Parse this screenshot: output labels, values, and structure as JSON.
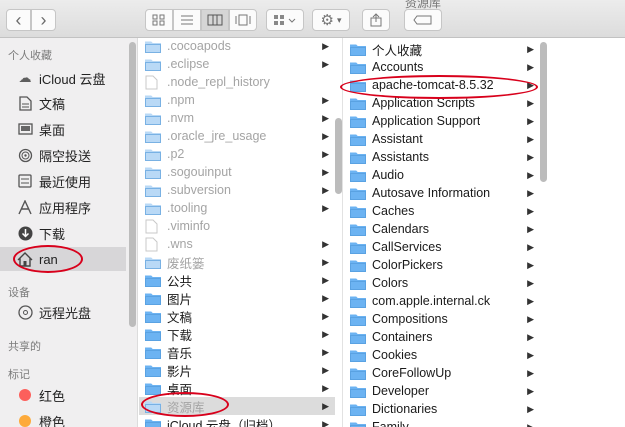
{
  "window": {
    "title": "资源库"
  },
  "toolbar": {
    "back": "‹",
    "forward": "›",
    "view_icons": [
      "icon-view",
      "list-view",
      "column-view",
      "gallery-view"
    ],
    "arrange": "arrange-menu",
    "action": "gear-menu",
    "share": "share",
    "tags": "tags"
  },
  "sidebar": {
    "favorites_header": "个人收藏",
    "favorites": [
      {
        "label": "iCloud 云盘",
        "icon": "cloud-icon"
      },
      {
        "label": "文稿",
        "icon": "document-icon"
      },
      {
        "label": "桌面",
        "icon": "desktop-icon"
      },
      {
        "label": "隔空投送",
        "icon": "airdrop-icon"
      },
      {
        "label": "最近使用",
        "icon": "recents-icon"
      },
      {
        "label": "应用程序",
        "icon": "applications-icon"
      },
      {
        "label": "下载",
        "icon": "downloads-icon"
      },
      {
        "label": "ran",
        "icon": "home-icon",
        "selected": true
      }
    ],
    "devices_header": "设备",
    "devices": [
      {
        "label": "远程光盘",
        "icon": "disc-icon"
      }
    ],
    "shared_header": "共享的",
    "tags_header": "标记",
    "tags": [
      {
        "label": "红色",
        "color": "#fc605c"
      },
      {
        "label": "橙色",
        "color": "#fdaa3b"
      }
    ]
  },
  "column1": {
    "items": [
      {
        "label": ".cocoapods",
        "kind": "folder",
        "dim": true,
        "arrow": true
      },
      {
        "label": ".eclipse",
        "kind": "folder",
        "dim": true,
        "arrow": true
      },
      {
        "label": ".node_repl_history",
        "kind": "file",
        "dim": true,
        "arrow": false
      },
      {
        "label": ".npm",
        "kind": "folder",
        "dim": true,
        "arrow": true
      },
      {
        "label": ".nvm",
        "kind": "folder",
        "dim": true,
        "arrow": true
      },
      {
        "label": ".oracle_jre_usage",
        "kind": "folder",
        "dim": true,
        "arrow": true
      },
      {
        "label": ".p2",
        "kind": "folder",
        "dim": true,
        "arrow": true
      },
      {
        "label": ".sogouinput",
        "kind": "folder",
        "dim": true,
        "arrow": true
      },
      {
        "label": ".subversion",
        "kind": "folder",
        "dim": true,
        "arrow": true
      },
      {
        "label": ".tooling",
        "kind": "folder",
        "dim": true,
        "arrow": true
      },
      {
        "label": ".viminfo",
        "kind": "file",
        "dim": true,
        "arrow": false
      },
      {
        "label": ".wns",
        "kind": "file",
        "dim": true,
        "arrow": true
      },
      {
        "label": "废纸篓",
        "kind": "folder",
        "dim": true,
        "arrow": true
      },
      {
        "label": "公共",
        "kind": "folder",
        "dim": false,
        "arrow": true
      },
      {
        "label": "图片",
        "kind": "folder",
        "dim": false,
        "arrow": true
      },
      {
        "label": "文稿",
        "kind": "folder",
        "dim": false,
        "arrow": true
      },
      {
        "label": "下载",
        "kind": "folder",
        "dim": false,
        "arrow": true
      },
      {
        "label": "音乐",
        "kind": "folder",
        "dim": false,
        "arrow": true
      },
      {
        "label": "影片",
        "kind": "folder",
        "dim": false,
        "arrow": true
      },
      {
        "label": "桌面",
        "kind": "folder",
        "dim": false,
        "arrow": true
      },
      {
        "label": "资源库",
        "kind": "folder",
        "dim": true,
        "arrow": true,
        "selected": true
      },
      {
        "label": "iCloud 云盘（归档）",
        "kind": "folder",
        "dim": false,
        "arrow": true
      }
    ]
  },
  "column2": {
    "items": [
      {
        "label": "个人收藏",
        "arrow": true
      },
      {
        "label": "Accounts",
        "arrow": true
      },
      {
        "label": "apache-tomcat-8.5.32",
        "arrow": true
      },
      {
        "label": "Application Scripts",
        "arrow": true
      },
      {
        "label": "Application Support",
        "arrow": true
      },
      {
        "label": "Assistant",
        "arrow": true
      },
      {
        "label": "Assistants",
        "arrow": true
      },
      {
        "label": "Audio",
        "arrow": true
      },
      {
        "label": "Autosave Information",
        "arrow": true
      },
      {
        "label": "Caches",
        "arrow": true
      },
      {
        "label": "Calendars",
        "arrow": true
      },
      {
        "label": "CallServices",
        "arrow": true
      },
      {
        "label": "ColorPickers",
        "arrow": true
      },
      {
        "label": "Colors",
        "arrow": true
      },
      {
        "label": "com.apple.internal.ck",
        "arrow": true
      },
      {
        "label": "Compositions",
        "arrow": true
      },
      {
        "label": "Containers",
        "arrow": true
      },
      {
        "label": "Cookies",
        "arrow": true
      },
      {
        "label": "CoreFollowUp",
        "arrow": true
      },
      {
        "label": "Developer",
        "arrow": true
      },
      {
        "label": "Dictionaries",
        "arrow": true
      },
      {
        "label": "Family",
        "arrow": true
      }
    ]
  },
  "colors": {
    "folder": "#6cb3f2",
    "folder_dim": "#b9d9f6",
    "annotation": "#d8001b",
    "selected_row": "#dcdcdc"
  }
}
